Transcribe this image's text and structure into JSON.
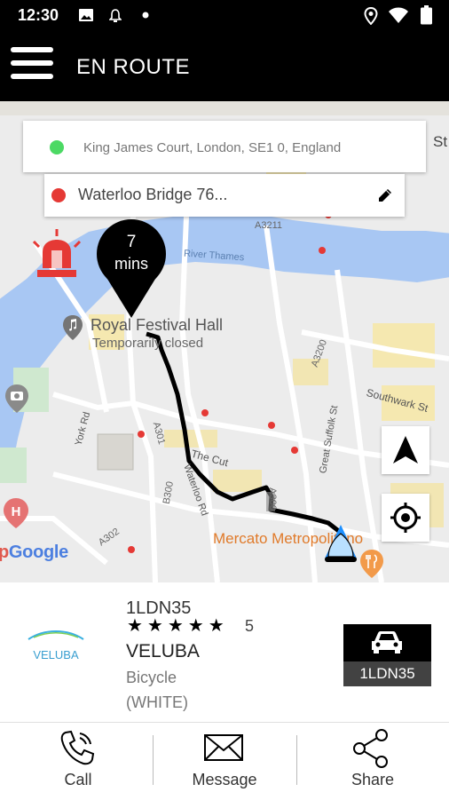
{
  "status_bar": {
    "time": "12:30",
    "icons": [
      "image-icon",
      "notification-bell-icon",
      "dot-icon",
      "location-icon",
      "wifi-icon",
      "battery-icon"
    ]
  },
  "app_bar": {
    "title": "EN ROUTE",
    "menu_icon": "hamburger-menu-icon"
  },
  "route": {
    "pickup": {
      "address": "King James Court, London, SE1 0, England",
      "color": "#4cd964"
    },
    "dropoff": {
      "address": "Waterloo Bridge 76...",
      "color": "#e53935"
    },
    "edit_icon": "pencil-icon"
  },
  "eta_marker": {
    "value": "7",
    "unit": "mins"
  },
  "map": {
    "poi": {
      "name": "Royal Festival Hall",
      "status": "Temporarily closed"
    },
    "place_labels": {
      "river": "River Thames",
      "mercato": "Mercato Metropolitano",
      "southwark": "Southwark St",
      "the_cut": "The Cut",
      "waterloo_rd": "Waterloo Rd",
      "york_rd": "York Rd",
      "great_suffolk": "Great Suffolk St",
      "a3211": "A3211",
      "a3200": "A3200",
      "a301": "A301",
      "b300": "B300",
      "a302": "A302",
      "a300": "A300"
    },
    "watermark": "Google",
    "edge_text": "St",
    "compass_icon": "navigation-arrow-icon",
    "locate_icon": "my-location-icon"
  },
  "vehicle": {
    "plate": "1LDN35",
    "rating_stars": "★★★★★",
    "rating": "5",
    "brand": "VELUBA",
    "type": "Bicycle",
    "color_label": "(WHITE)",
    "logo_text": "VELUBA",
    "badge_plate": "1LDN35"
  },
  "actions": {
    "call": "Call",
    "message": "Message",
    "share": "Share"
  }
}
